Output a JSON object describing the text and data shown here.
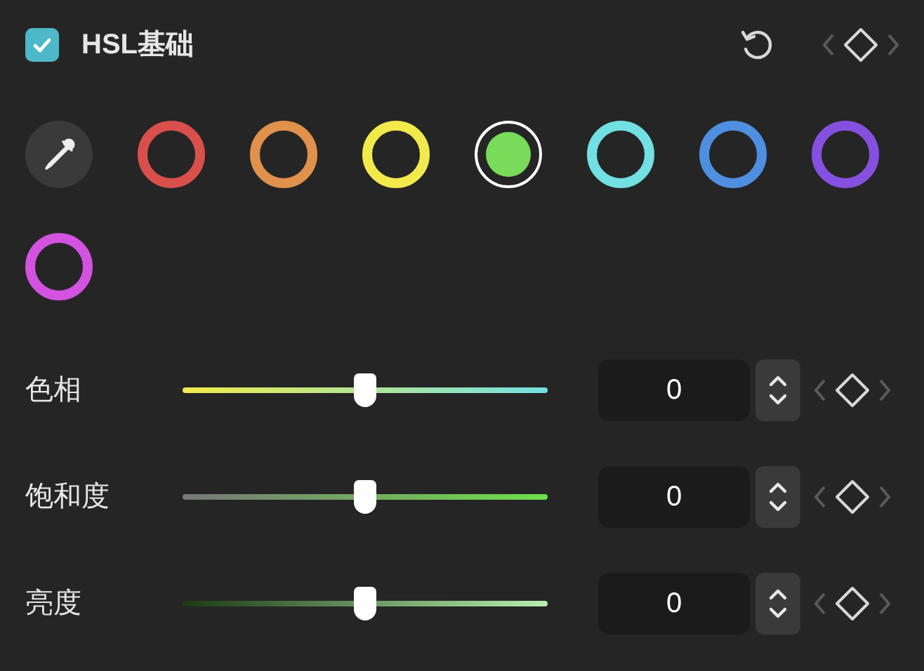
{
  "header": {
    "checked": true,
    "title": "HSL基础"
  },
  "swatches": [
    {
      "kind": "eyedropper",
      "selected": false
    },
    {
      "kind": "color",
      "color": "#d84f4c",
      "selected": false
    },
    {
      "kind": "color",
      "color": "#e0914b",
      "selected": false
    },
    {
      "kind": "color",
      "color": "#f2ea4b",
      "selected": false
    },
    {
      "kind": "color",
      "color": "#78dc5a",
      "selected": true
    },
    {
      "kind": "color",
      "color": "#72e0e2",
      "selected": false
    },
    {
      "kind": "color",
      "color": "#4f8fe0",
      "selected": false
    },
    {
      "kind": "color",
      "color": "#8550e0",
      "selected": false
    },
    {
      "kind": "color",
      "color": "#d352e0",
      "selected": false
    }
  ],
  "sliders": [
    {
      "kind": "hue",
      "label": "色相",
      "level": 0.5,
      "value": "0"
    },
    {
      "kind": "saturation",
      "label": "饱和度",
      "level": 0.5,
      "value": "0"
    },
    {
      "kind": "lightness",
      "label": "亮度",
      "level": 0.5,
      "value": "0"
    }
  ]
}
